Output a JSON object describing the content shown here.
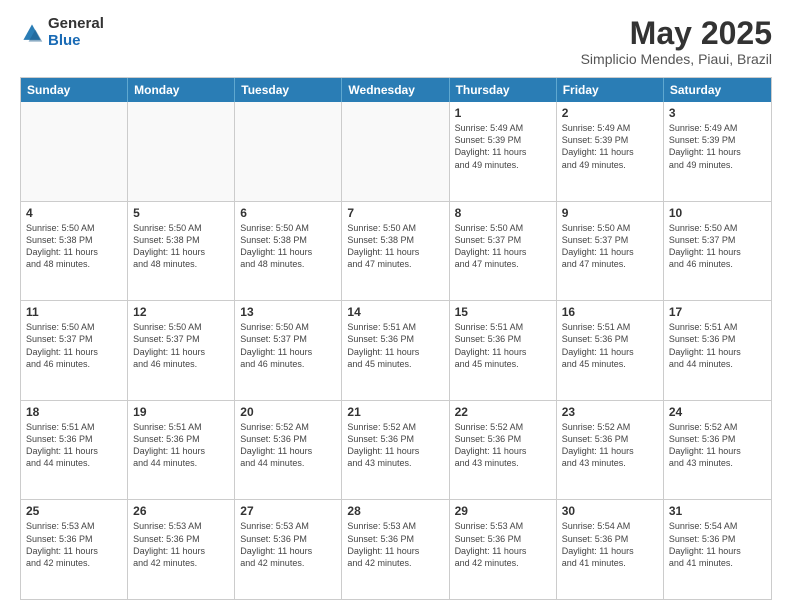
{
  "logo": {
    "general": "General",
    "blue": "Blue"
  },
  "header": {
    "month": "May 2025",
    "location": "Simplicio Mendes, Piaui, Brazil"
  },
  "days": [
    "Sunday",
    "Monday",
    "Tuesday",
    "Wednesday",
    "Thursday",
    "Friday",
    "Saturday"
  ],
  "weeks": [
    [
      {
        "day": "",
        "text": ""
      },
      {
        "day": "",
        "text": ""
      },
      {
        "day": "",
        "text": ""
      },
      {
        "day": "",
        "text": ""
      },
      {
        "day": "1",
        "text": "Sunrise: 5:49 AM\nSunset: 5:39 PM\nDaylight: 11 hours\nand 49 minutes."
      },
      {
        "day": "2",
        "text": "Sunrise: 5:49 AM\nSunset: 5:39 PM\nDaylight: 11 hours\nand 49 minutes."
      },
      {
        "day": "3",
        "text": "Sunrise: 5:49 AM\nSunset: 5:39 PM\nDaylight: 11 hours\nand 49 minutes."
      }
    ],
    [
      {
        "day": "4",
        "text": "Sunrise: 5:50 AM\nSunset: 5:38 PM\nDaylight: 11 hours\nand 48 minutes."
      },
      {
        "day": "5",
        "text": "Sunrise: 5:50 AM\nSunset: 5:38 PM\nDaylight: 11 hours\nand 48 minutes."
      },
      {
        "day": "6",
        "text": "Sunrise: 5:50 AM\nSunset: 5:38 PM\nDaylight: 11 hours\nand 48 minutes."
      },
      {
        "day": "7",
        "text": "Sunrise: 5:50 AM\nSunset: 5:38 PM\nDaylight: 11 hours\nand 47 minutes."
      },
      {
        "day": "8",
        "text": "Sunrise: 5:50 AM\nSunset: 5:37 PM\nDaylight: 11 hours\nand 47 minutes."
      },
      {
        "day": "9",
        "text": "Sunrise: 5:50 AM\nSunset: 5:37 PM\nDaylight: 11 hours\nand 47 minutes."
      },
      {
        "day": "10",
        "text": "Sunrise: 5:50 AM\nSunset: 5:37 PM\nDaylight: 11 hours\nand 46 minutes."
      }
    ],
    [
      {
        "day": "11",
        "text": "Sunrise: 5:50 AM\nSunset: 5:37 PM\nDaylight: 11 hours\nand 46 minutes."
      },
      {
        "day": "12",
        "text": "Sunrise: 5:50 AM\nSunset: 5:37 PM\nDaylight: 11 hours\nand 46 minutes."
      },
      {
        "day": "13",
        "text": "Sunrise: 5:50 AM\nSunset: 5:37 PM\nDaylight: 11 hours\nand 46 minutes."
      },
      {
        "day": "14",
        "text": "Sunrise: 5:51 AM\nSunset: 5:36 PM\nDaylight: 11 hours\nand 45 minutes."
      },
      {
        "day": "15",
        "text": "Sunrise: 5:51 AM\nSunset: 5:36 PM\nDaylight: 11 hours\nand 45 minutes."
      },
      {
        "day": "16",
        "text": "Sunrise: 5:51 AM\nSunset: 5:36 PM\nDaylight: 11 hours\nand 45 minutes."
      },
      {
        "day": "17",
        "text": "Sunrise: 5:51 AM\nSunset: 5:36 PM\nDaylight: 11 hours\nand 44 minutes."
      }
    ],
    [
      {
        "day": "18",
        "text": "Sunrise: 5:51 AM\nSunset: 5:36 PM\nDaylight: 11 hours\nand 44 minutes."
      },
      {
        "day": "19",
        "text": "Sunrise: 5:51 AM\nSunset: 5:36 PM\nDaylight: 11 hours\nand 44 minutes."
      },
      {
        "day": "20",
        "text": "Sunrise: 5:52 AM\nSunset: 5:36 PM\nDaylight: 11 hours\nand 44 minutes."
      },
      {
        "day": "21",
        "text": "Sunrise: 5:52 AM\nSunset: 5:36 PM\nDaylight: 11 hours\nand 43 minutes."
      },
      {
        "day": "22",
        "text": "Sunrise: 5:52 AM\nSunset: 5:36 PM\nDaylight: 11 hours\nand 43 minutes."
      },
      {
        "day": "23",
        "text": "Sunrise: 5:52 AM\nSunset: 5:36 PM\nDaylight: 11 hours\nand 43 minutes."
      },
      {
        "day": "24",
        "text": "Sunrise: 5:52 AM\nSunset: 5:36 PM\nDaylight: 11 hours\nand 43 minutes."
      }
    ],
    [
      {
        "day": "25",
        "text": "Sunrise: 5:53 AM\nSunset: 5:36 PM\nDaylight: 11 hours\nand 42 minutes."
      },
      {
        "day": "26",
        "text": "Sunrise: 5:53 AM\nSunset: 5:36 PM\nDaylight: 11 hours\nand 42 minutes."
      },
      {
        "day": "27",
        "text": "Sunrise: 5:53 AM\nSunset: 5:36 PM\nDaylight: 11 hours\nand 42 minutes."
      },
      {
        "day": "28",
        "text": "Sunrise: 5:53 AM\nSunset: 5:36 PM\nDaylight: 11 hours\nand 42 minutes."
      },
      {
        "day": "29",
        "text": "Sunrise: 5:53 AM\nSunset: 5:36 PM\nDaylight: 11 hours\nand 42 minutes."
      },
      {
        "day": "30",
        "text": "Sunrise: 5:54 AM\nSunset: 5:36 PM\nDaylight: 11 hours\nand 41 minutes."
      },
      {
        "day": "31",
        "text": "Sunrise: 5:54 AM\nSunset: 5:36 PM\nDaylight: 11 hours\nand 41 minutes."
      }
    ]
  ]
}
